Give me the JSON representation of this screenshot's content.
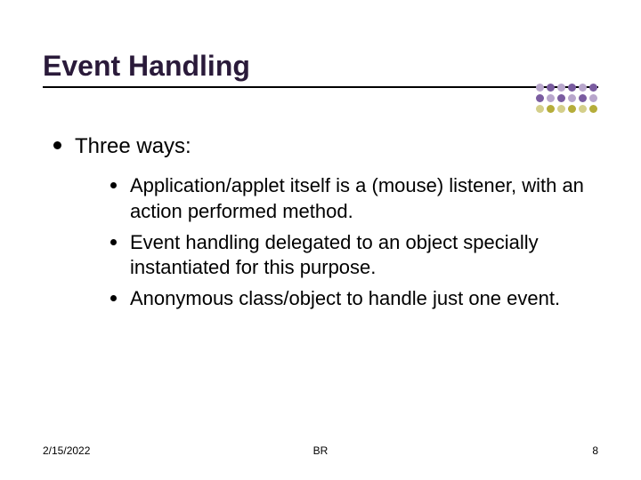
{
  "title": "Event Handling",
  "bullet_l1": "Three ways:",
  "bullets_l2": [
    "Application/applet itself is a (mouse) listener, with an action performed method.",
    "Event handling delegated to an object specially instantiated for this purpose.",
    "Anonymous class/object to handle just one event."
  ],
  "footer": {
    "date": "2/15/2022",
    "center": "BR",
    "page": "8"
  }
}
